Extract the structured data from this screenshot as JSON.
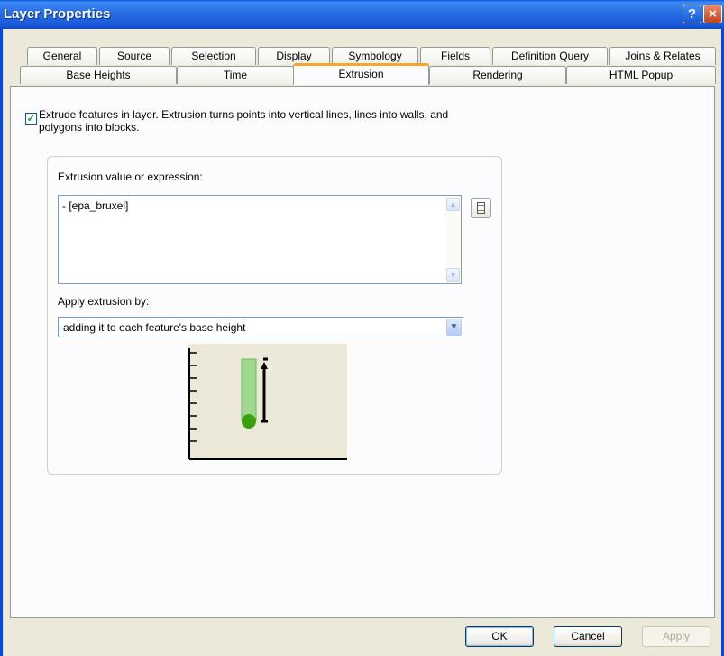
{
  "window": {
    "title": "Layer Properties",
    "help_glyph": "?",
    "close_glyph": "×"
  },
  "tabs": {
    "row_top": [
      "General",
      "Source",
      "Selection",
      "Display",
      "Symbology",
      "Fields",
      "Definition Query",
      "Joins & Relates"
    ],
    "row_bottom": [
      "Base Heights",
      "Time",
      "Extrusion",
      "Rendering",
      "HTML Popup"
    ],
    "active": "Extrusion"
  },
  "extrude": {
    "checked": true,
    "check_glyph": "✓",
    "label": "Extrude features in layer.  Extrusion turns points into vertical lines, lines into walls, and polygons into blocks."
  },
  "expression": {
    "label": "Extrusion value or expression:",
    "value": "- [epa_bruxel]",
    "calculator_icon": "calculator-icon"
  },
  "apply": {
    "label": "Apply extrusion by:",
    "selected": "adding it to each feature's base height"
  },
  "colors": {
    "titlebar": "#2a6fe6",
    "tab_highlight": "#f4a72c",
    "diagram_fill": "#9fd98f",
    "diagram_base": "#3aa10e",
    "diagram_bg": "#ece9d8"
  },
  "footer": {
    "ok": "OK",
    "cancel": "Cancel",
    "apply": "Apply"
  }
}
